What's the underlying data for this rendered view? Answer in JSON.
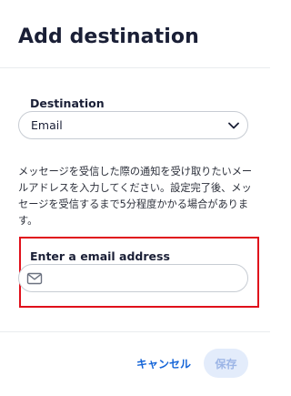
{
  "dialog": {
    "title": "Add destination"
  },
  "destination": {
    "label": "Destination",
    "selected": "Email"
  },
  "helper_text": "メッセージを受信した際の通知を受け取りたいメールアドレスを入力してください。設定完了後、メッセージを受信するまで5分程度かかる場合があります。",
  "email": {
    "label": "Enter a email address",
    "value": "",
    "placeholder": ""
  },
  "footer": {
    "cancel_label": "キャンセル",
    "save_label": "保存"
  },
  "colors": {
    "accent": "#1565d8",
    "save_disabled_bg": "#e3ecfb",
    "highlight_border": "#e0101b"
  },
  "icons": {
    "select_chevron": "chevron-down-icon",
    "email_field": "mail-icon"
  }
}
